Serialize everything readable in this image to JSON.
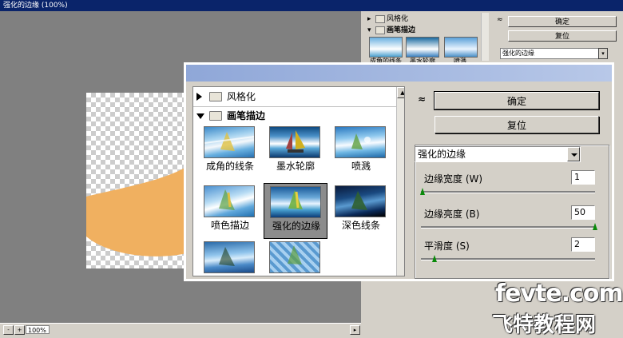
{
  "window": {
    "title": "强化的边缘 (100%)"
  },
  "status": {
    "zoom": "100%"
  },
  "background_panel": {
    "categories": [
      {
        "label": "风格化",
        "expanded": false
      },
      {
        "label": "画笔描边",
        "expanded": true
      }
    ],
    "filters": [
      "成角的线条",
      "墨水轮廓",
      "喷溅"
    ],
    "ok_label": "确定",
    "reset_label": "复位",
    "selected_filter": "强化的边缘"
  },
  "dialog": {
    "categories": [
      {
        "label": "风格化",
        "expanded": false
      },
      {
        "label": "画笔描边",
        "expanded": true
      }
    ],
    "filters": [
      {
        "label": "成角的线条",
        "selected": false
      },
      {
        "label": "墨水轮廓",
        "selected": false
      },
      {
        "label": "喷溅",
        "selected": false
      },
      {
        "label": "喷色描边",
        "selected": false
      },
      {
        "label": "强化的边缘",
        "selected": true
      },
      {
        "label": "深色线条",
        "selected": false
      },
      {
        "label": "",
        "selected": false
      },
      {
        "label": "",
        "selected": false
      }
    ],
    "collapse_glyph": "≈",
    "ok_label": "确定",
    "reset_label": "复位",
    "filter_select": "强化的边缘",
    "params": [
      {
        "label": "边缘宽度 (W)",
        "value": "1",
        "slider_fraction": 0.0
      },
      {
        "label": "边缘亮度 (B)",
        "value": "50",
        "slider_fraction": 1.0
      },
      {
        "label": "平滑度 (S)",
        "value": "2",
        "slider_fraction": 0.07
      }
    ]
  },
  "watermark": {
    "line1": "fevte.com",
    "line2": "飞特教程网"
  },
  "colors": {
    "titlebar": "#0a246a",
    "canvas_bg": "#808080",
    "shape": "#f0b060",
    "slider_thumb": "#0a8a0a"
  }
}
